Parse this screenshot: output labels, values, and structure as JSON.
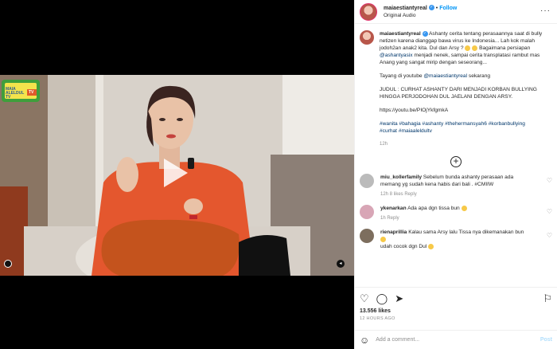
{
  "header": {
    "username": "maiaestiantyreal",
    "follow_label": "Follow",
    "separator": "•",
    "subtitle": "Original Audio",
    "more": "···"
  },
  "caption": {
    "username": "maiaestiantyreal",
    "p1_lead": "Ashanty cerita tentang perasaannya saat di bully netizen karena dianggap bawa virus ke Indonesia... Lah kok malah jodoh2an anak2 kita. Dul dan Arsy ? ",
    "p1_mid": " Bagaimana persiapan ",
    "p1_mention": "@ashantyasix",
    "p1_tail": " menjadi nenek, sampai cerita transplatasi rambut mas Anang yang sangat mirip dengan seseorang...",
    "p2_lead": "Tayang di youtube ",
    "p2_mention": "@maiaestiantyreal",
    "p2_tail": " sekarang",
    "p3": "JUDUL : CURHAT ASHANTY DARI MENJADI KORBAN BULLYING HINGGA PERJODOHAN DUL JAELANI DENGAN ARSY.",
    "p4": "https://youtu.be/PIOjYkfgmkA",
    "hashtags": "#wanita #bahagia #ashanty #thehermansyah6 #korbanbullying #curhat #maiaaleldultv",
    "time": "12h"
  },
  "comments": [
    {
      "user": "miu_kollerfamily",
      "text": "Sebelum bunda ashanty perasaan ada memang yg sudah kena habis dari bali . #CMIIW",
      "meta": "12h   8 likes   Reply"
    },
    {
      "user": "ykenarkan",
      "text": "Ada apa dgn tissa bun ",
      "meta": "1h   Reply"
    },
    {
      "user": "rienaprillia",
      "text": "Kalau sama Arsy lalu Tissa nya dikemanakan bun ",
      "text2": "udah cocok dgn Dul ",
      "meta": ""
    }
  ],
  "video": {
    "tv_label": "MAIA ALELDUL TV",
    "tv_badge": "TV"
  },
  "actions": {
    "likes": "13.556 likes",
    "ago": "12 HOURS AGO"
  },
  "add_comment": {
    "placeholder": "Add a comment...",
    "post": "Post"
  },
  "colors": {
    "accent": "#0095f6",
    "dress": "#e4572e",
    "pillow": "#c4531d"
  }
}
